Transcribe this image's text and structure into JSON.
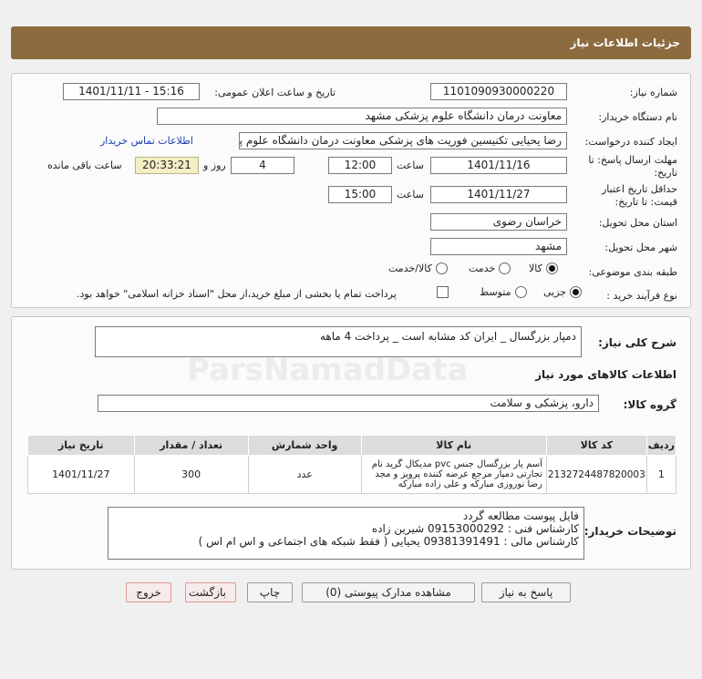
{
  "header": {
    "title": "جزئیات اطلاعات نیاز"
  },
  "form": {
    "need_number_label": "شماره نیاز:",
    "need_number": "1101090930000220",
    "announce_label": "تاریخ و ساعت اعلان عمومی:",
    "announce_value": "1401/11/11 - 15:16",
    "buyer_label": "نام دستگاه خریدار:",
    "buyer_value": "معاونت درمان دانشگاه علوم پزشکی مشهد",
    "creator_label": "ایجاد کننده درخواست:",
    "creator_value": "رضا یحیایی تکنیسین فوریت های پزشکی معاونت درمان دانشگاه علوم پزشکی م",
    "contact_link": "اطلاعات تماس خریدار",
    "deadline_label_1": "مهلت ارسال پاسخ: تا",
    "deadline_label_2": "تاریخ:",
    "deadline_date": "1401/11/16",
    "time_label": "ساعت",
    "deadline_time": "12:00",
    "days_value": "4",
    "days_label": "روز و",
    "remaining_value": "20:33:21",
    "remaining_label": "ساعت باقی مانده",
    "validity_label_1": "حداقل تاریخ اعتبار",
    "validity_label_2": "قیمت: تا تاریخ:",
    "validity_date": "1401/11/27",
    "validity_time": "15:00",
    "province_label": "استان محل تحویل:",
    "province_value": "خراسان رضوی",
    "city_label": "شهر محل تحویل:",
    "city_value": "مشهد",
    "category_label": "طبقه بندی موضوعی:",
    "category_options": [
      "کالا",
      "خدمت",
      "کالا/خدمت"
    ],
    "process_label": "نوع فرآیند خرید :",
    "process_options": [
      "جزیی",
      "متوسط"
    ],
    "payment_note": "پرداخت تمام یا بخشی از مبلغ خرید،از محل \"اسناد خزانه اسلامی\" خواهد بود."
  },
  "summary": {
    "desc_label": "شرح کلی نیاز:",
    "desc_value": "دمپار بزرگسال _ ایران کد مشابه است _ پرداخت 4 ماهه",
    "goods_info_title": "اطلاعات کالاهای مورد نیاز",
    "group_label": "گروه کالا:",
    "group_value": "دارو، پزشکی و سلامت"
  },
  "table": {
    "headers": [
      "ردیف",
      "کد کالا",
      "نام کالا",
      "واحد شمارش",
      "تعداد / مقدار",
      "تاریخ نیاز"
    ],
    "rows": [
      {
        "row": "1",
        "code": "2132724487820003",
        "name": "آسم یار بزرگسال جنس pvc مدیکال گرید نام تجارتی دمپار مرجع عرضه کننده پرویز و مجد رضا نوروزی مبارکه و علی زاده مبارکه",
        "unit": "عدد",
        "qty": "300",
        "date": "1401/11/27"
      }
    ]
  },
  "notes": {
    "label": "توضیحات خریدار:",
    "lines": [
      "فایل پیوست مطالعه گردد",
      "کارشناس فنی : 09153000292 شیرین زاده",
      "کارشناس مالی : 09381391491 یحیایی ( فقط شبکه های اجتماعی و اس ام اس )"
    ]
  },
  "buttons": {
    "reply": "پاسخ به نیاز",
    "attachments": "مشاهده مدارک پیوستی (0)",
    "print": "چاپ",
    "back": "بازگشت",
    "exit": "خروج"
  },
  "colors": {
    "header_bg": "#8c6b3f",
    "link": "#1a3fb0",
    "timer_bg": "#f3eec3"
  }
}
